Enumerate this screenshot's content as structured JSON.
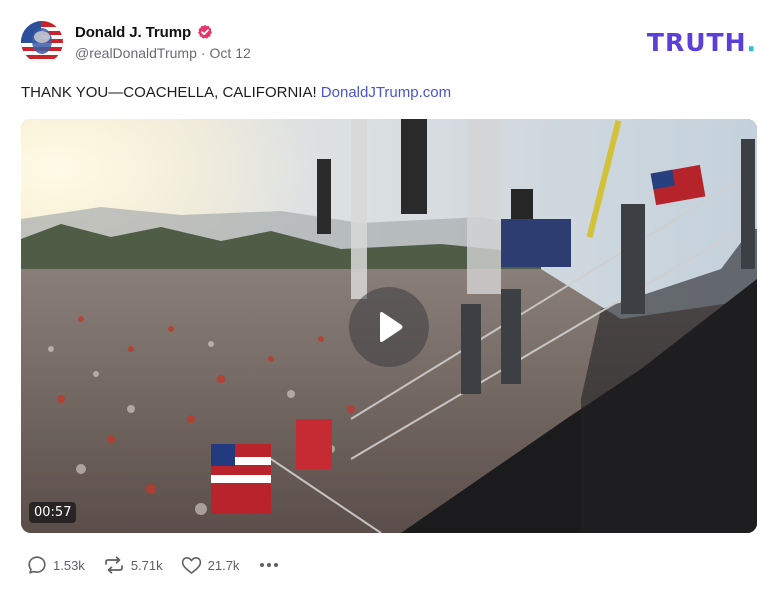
{
  "post": {
    "author": {
      "display_name": "Donald J. Trump",
      "handle": "@realDonaldTrump",
      "date": "Oct 12",
      "verified": true
    },
    "brand": {
      "wordmark": "TRUTH",
      "dot": ".",
      "color": "#5b3fd9",
      "dot_color": "#27c0c7"
    },
    "text": "THANK YOU—COACHELLA, CALIFORNIA!",
    "link_text": "DonaldJTrump.com",
    "media": {
      "type": "video",
      "duration": "00:57"
    },
    "stats": {
      "replies": "1.53k",
      "retruths": "5.71k",
      "likes": "21.7k"
    }
  },
  "icons": {
    "verified": "verified-badge-icon",
    "play": "play-icon",
    "reply": "reply-icon",
    "retruth": "retruth-icon",
    "like": "heart-icon",
    "more": "more-icon"
  }
}
